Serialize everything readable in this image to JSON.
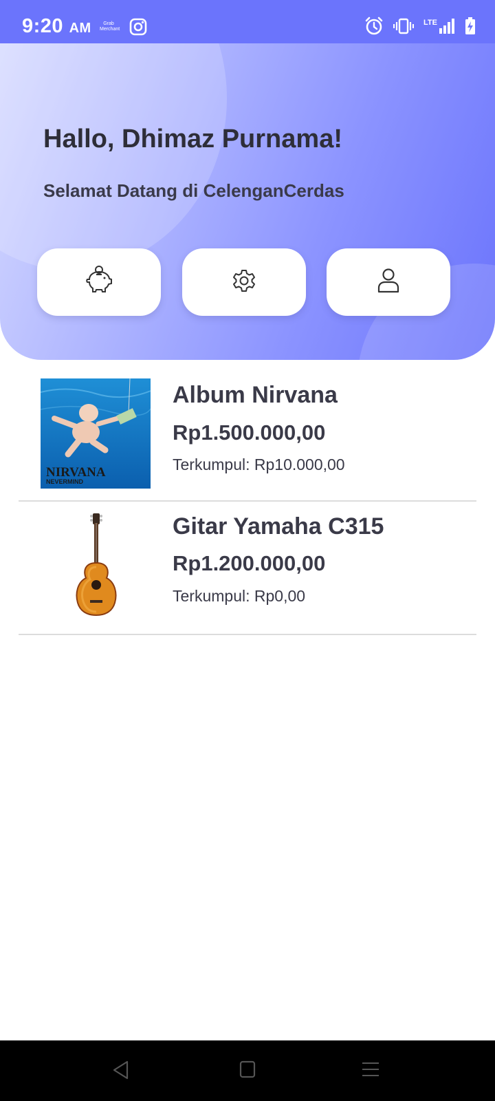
{
  "status_bar": {
    "time": "9:20",
    "ampm": "AM",
    "tiny_app_label": "Grab Merchant",
    "network": "LTE",
    "icons": [
      "instagram-icon",
      "alarm-icon",
      "vibrate-icon",
      "signal-icon",
      "battery-charging-icon"
    ]
  },
  "header": {
    "greeting": "Hallo, Dhimaz Purnama!",
    "subtitle": "Selamat Datang di CelenganCerdas",
    "actions": [
      {
        "icon": "piggy-bank-icon"
      },
      {
        "icon": "settings-gear-icon"
      },
      {
        "icon": "user-profile-icon"
      }
    ]
  },
  "items": [
    {
      "title": "Album Nirvana",
      "price": "Rp1.500.000,00",
      "saved": "Terkumpul: Rp10.000,00",
      "image_text_line1": "NIRVANA",
      "image_text_line2": "NEVERMIND"
    },
    {
      "title": "Gitar Yamaha C315",
      "price": "Rp1.200.000,00",
      "saved": "Terkumpul: Rp0,00"
    }
  ],
  "colors": {
    "accent": "#6b74fc",
    "header_light": "#d6daff",
    "text_dark": "#3a3a48",
    "divider": "#dcdcdc"
  },
  "nav_bar": {
    "buttons": [
      "back-icon",
      "home-icon",
      "recents-menu-icon"
    ]
  }
}
